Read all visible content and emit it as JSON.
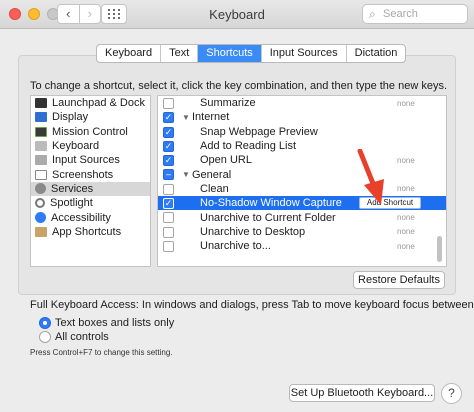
{
  "window": {
    "title": "Keyboard"
  },
  "toolbar": {
    "back_icon": "chevron-left-icon",
    "forward_icon": "chevron-right-icon",
    "show_all_icon": "grid-icon"
  },
  "search": {
    "placeholder": "Search"
  },
  "tabs": [
    {
      "label": "Keyboard",
      "active": false
    },
    {
      "label": "Text",
      "active": false
    },
    {
      "label": "Shortcuts",
      "active": true
    },
    {
      "label": "Input Sources",
      "active": false
    },
    {
      "label": "Dictation",
      "active": false
    }
  ],
  "instructions": "To change a shortcut, select it, click the key combination, and then type the new keys.",
  "categories": [
    {
      "label": "Launchpad & Dock",
      "icon": "launchpad-icon",
      "selected": false
    },
    {
      "label": "Display",
      "icon": "display-icon",
      "selected": false
    },
    {
      "label": "Mission Control",
      "icon": "mission-control-icon",
      "selected": false
    },
    {
      "label": "Keyboard",
      "icon": "keyboard-icon",
      "selected": false
    },
    {
      "label": "Input Sources",
      "icon": "input-sources-icon",
      "selected": false
    },
    {
      "label": "Screenshots",
      "icon": "screenshots-icon",
      "selected": false
    },
    {
      "label": "Services",
      "icon": "gear-icon",
      "selected": true
    },
    {
      "label": "Spotlight",
      "icon": "spotlight-icon",
      "selected": false
    },
    {
      "label": "Accessibility",
      "icon": "accessibility-icon",
      "selected": false
    },
    {
      "label": "App Shortcuts",
      "icon": "app-shortcuts-icon",
      "selected": false
    }
  ],
  "shortcuts": [
    {
      "label": "Summarize",
      "checked": false,
      "shortcut": "none",
      "indent": 2
    },
    {
      "label": "Internet",
      "group": true,
      "checked": true,
      "indent": 1
    },
    {
      "label": "Snap Webpage Preview",
      "checked": true,
      "shortcut": "",
      "indent": 2
    },
    {
      "label": "Add to Reading List",
      "checked": true,
      "shortcut": "",
      "indent": 2
    },
    {
      "label": "Open URL",
      "checked": true,
      "shortcut": "none",
      "indent": 2
    },
    {
      "label": "General",
      "group": true,
      "checked": "mixed",
      "indent": 1
    },
    {
      "label": "Clean",
      "checked": false,
      "shortcut": "none",
      "indent": 2
    },
    {
      "label": "No-Shadow Window Capture",
      "checked": true,
      "selected": true,
      "action": "Add Shortcut",
      "indent": 2
    },
    {
      "label": "Unarchive to Current Folder",
      "checked": false,
      "shortcut": "none",
      "indent": 2
    },
    {
      "label": "Unarchive to Desktop",
      "checked": false,
      "shortcut": "none",
      "indent": 2
    },
    {
      "label": "Unarchive to...",
      "checked": false,
      "shortcut": "none",
      "indent": 2
    }
  ],
  "buttons": {
    "restore_defaults": "Restore Defaults",
    "bluetooth": "Set Up Bluetooth Keyboard...",
    "help": "?"
  },
  "full_access": {
    "label": "Full Keyboard Access: In windows and dialogs, press Tab to move keyboard focus between:",
    "options": [
      {
        "label": "Text boxes and lists only",
        "selected": true
      },
      {
        "label": "All controls",
        "selected": false
      }
    ],
    "note": "Press Control+F7 to change this setting."
  },
  "colors": {
    "accent": "#1e6ff0",
    "arrow": "#e8402a"
  }
}
